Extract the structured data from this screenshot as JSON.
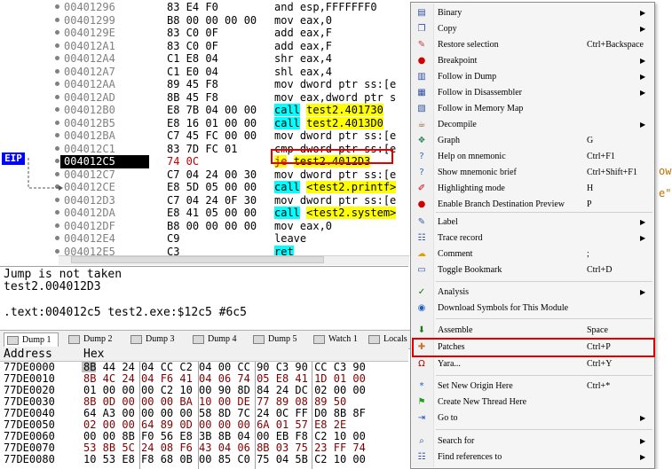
{
  "disasm": {
    "eip_label": "EIP",
    "rows": [
      {
        "addr": "00401296",
        "bytes": "83 E4 F0",
        "ins": "and esp,FFFFFFF0"
      },
      {
        "addr": "00401299",
        "bytes": "B8 00 00 00 00",
        "ins": "mov eax,0"
      },
      {
        "addr": "0040129E",
        "bytes": "83 C0 0F",
        "ins": "add eax,F"
      },
      {
        "addr": "004012A1",
        "bytes": "83 C0 0F",
        "ins": "add eax,F"
      },
      {
        "addr": "004012A4",
        "bytes": "C1 E8 04",
        "ins": "shr eax,4"
      },
      {
        "addr": "004012A7",
        "bytes": "C1 E0 04",
        "ins": "shl eax,4"
      },
      {
        "addr": "004012AA",
        "bytes": "89 45 F8",
        "ins": "mov dword ptr ss:[e"
      },
      {
        "addr": "004012AD",
        "bytes": "8B 45 F8",
        "ins": "mov eax,dword ptr s"
      },
      {
        "addr": "004012B0",
        "bytes": "E8 7B 04 00 00",
        "ins_call": "call",
        "ins_target": "test2.401730"
      },
      {
        "addr": "004012B5",
        "bytes": "E8 16 01 00 00",
        "ins_call": "call",
        "ins_target": "test2.4013D0"
      },
      {
        "addr": "004012BA",
        "bytes": "C7 45 FC 00 00",
        "ins": "mov dword ptr ss:[e"
      },
      {
        "addr": "004012C1",
        "bytes": "83 7D FC 01",
        "ins": "cmp dword ptr ss:[e"
      },
      {
        "addr": "004012C5",
        "bytes": "74 0C",
        "ins_je": "je",
        "ins_target": "test2.4012D3"
      },
      {
        "addr": "004012C7",
        "bytes": "C7 04 24 00 30",
        "ins": "mov dword ptr ss:[e"
      },
      {
        "addr": "004012CE",
        "bytes": "E8 5D 05 00 00",
        "ins_call": "call",
        "ins_target": "<test2.printf>"
      },
      {
        "addr": "004012D3",
        "bytes": "C7 04 24 0F 30",
        "ins": "mov dword ptr ss:[e"
      },
      {
        "addr": "004012DA",
        "bytes": "E8 41 05 00 00",
        "ins_call": "call",
        "ins_target": "<test2.system>"
      },
      {
        "addr": "004012DF",
        "bytes": "B8 00 00 00 00",
        "ins": "mov eax,0"
      },
      {
        "addr": "004012E4",
        "bytes": "C9",
        "ins": "leave"
      },
      {
        "addr": "004012E5",
        "bytes": "C3",
        "ins_ret": "ret"
      }
    ],
    "side_fragments": [
      "ow",
      "e\""
    ]
  },
  "info": {
    "line1": "Jump is not taken",
    "line2": "test2.004012D3",
    "line3": ".text:004012c5 test2.exe:$12c5 #6c5"
  },
  "tabs": [
    {
      "label": "Dump 1",
      "active": true
    },
    {
      "label": "Dump 2"
    },
    {
      "label": "Dump 3"
    },
    {
      "label": "Dump 4"
    },
    {
      "label": "Dump 5"
    },
    {
      "label": "Watch 1"
    },
    {
      "label": "Locals"
    }
  ],
  "dump": {
    "header_address": "Address",
    "header_hex": "Hex",
    "rows": [
      {
        "addr": "77DE0000",
        "hex": "8B 44 24 04 CC C2 04 00 CC 90 C3 90 CC C3 90"
      },
      {
        "addr": "77DE0010",
        "hex": "8B 4C 24 04 F6 41 04 06 74 05 E8 41 1D 01 00"
      },
      {
        "addr": "77DE0020",
        "hex": "01 00 00 00 C2 10 00 90 8D 84 24 DC 02 00 00"
      },
      {
        "addr": "77DE0030",
        "hex": "8B 0D 00 00 00 BA 10 00 DE 77 89 08 89 50"
      },
      {
        "addr": "77DE0040",
        "hex": "64 A3 00 00 00 00 58 8D 7C 24 0C FF D0 8B 8F"
      },
      {
        "addr": "77DE0050",
        "hex": "02 00 00 64 89 0D 00 00 00 6A 01 57 E8 2E"
      },
      {
        "addr": "77DE0060",
        "hex": "00 00 8B F0 56 E8 3B 8B 04 00 EB F8 C2 10 00"
      },
      {
        "addr": "77DE0070",
        "hex": "53 8B 5C 24 08 F6 43 04 06 8B 03 75 23 FF 74"
      },
      {
        "addr": "77DE0080",
        "hex": "10 53 E8 F8 68 0B 00 85 C0 75 04 5B C2 10 00"
      }
    ]
  },
  "menu": {
    "items": [
      {
        "icon": "binary-icon",
        "glyph": "▤",
        "label": "Binary",
        "submenu": true
      },
      {
        "icon": "copy-icon",
        "glyph": "❐",
        "label": "Copy",
        "submenu": true
      },
      {
        "icon": "restore-icon",
        "glyph": "✎",
        "label": "Restore selection",
        "shortcut": "Ctrl+Backspace"
      },
      {
        "icon": "breakpoint-icon",
        "glyph": "●",
        "label": "Breakpoint",
        "submenu": true
      },
      {
        "icon": "dump-icon",
        "glyph": "▥",
        "label": "Follow in Dump",
        "submenu": true
      },
      {
        "icon": "disassembler-icon",
        "glyph": "▦",
        "label": "Follow in Disassembler",
        "submenu": true
      },
      {
        "icon": "memory-map-icon",
        "glyph": "▧",
        "label": "Follow in Memory Map"
      },
      {
        "icon": "decompile-icon",
        "glyph": "☕",
        "label": "Decompile",
        "submenu": true
      },
      {
        "icon": "graph-icon",
        "glyph": "❖",
        "label": "Graph",
        "shortcut": "G"
      },
      {
        "icon": "help-icon",
        "glyph": "?",
        "label": "Help on mnemonic",
        "shortcut": "Ctrl+F1"
      },
      {
        "icon": "brief-icon",
        "glyph": "?",
        "label": "Show mnemonic brief",
        "shortcut": "Ctrl+Shift+F1"
      },
      {
        "icon": "highlight-icon",
        "glyph": "✐",
        "label": "Highlighting mode",
        "shortcut": "H"
      },
      {
        "icon": "branch-icon",
        "glyph": "●",
        "label": "Enable Branch Destination Preview",
        "shortcut": "P"
      },
      {
        "icon": "label-icon",
        "glyph": "✎",
        "label": "Label",
        "submenu": true
      },
      {
        "icon": "trace-icon",
        "glyph": "☷",
        "label": "Trace record",
        "submenu": true
      },
      {
        "icon": "comment-icon",
        "glyph": "☁",
        "label": "Comment",
        "shortcut": ";"
      },
      {
        "icon": "bookmark-icon",
        "glyph": "▭",
        "label": "Toggle Bookmark",
        "shortcut": "Ctrl+D"
      },
      {
        "icon": "analysis-icon",
        "glyph": "✓",
        "label": "Analysis",
        "submenu": true
      },
      {
        "icon": "symbols-icon",
        "glyph": "◉",
        "label": "Download Symbols for This Module"
      },
      {
        "icon": "assemble-icon",
        "glyph": "⬇",
        "label": "Assemble",
        "shortcut": "Space"
      },
      {
        "icon": "patches-icon",
        "glyph": "✚",
        "label": "Patches",
        "shortcut": "Ctrl+P"
      },
      {
        "icon": "yara-icon",
        "glyph": "Ω",
        "label": "Yara...",
        "shortcut": "Ctrl+Y"
      },
      {
        "icon": "origin-icon",
        "glyph": "*",
        "label": "Set New Origin Here",
        "shortcut": "Ctrl+*"
      },
      {
        "icon": "thread-icon",
        "glyph": "⚑",
        "label": "Create New Thread Here"
      },
      {
        "icon": "goto-icon",
        "glyph": "⇥",
        "label": "Go to",
        "submenu": true
      },
      {
        "icon": "search-icon",
        "glyph": "⌕",
        "label": "Search for",
        "submenu": true
      },
      {
        "icon": "references-icon",
        "glyph": "☷",
        "label": "Find references to",
        "submenu": true
      }
    ]
  },
  "colors": {
    "call_bg": "#00ffff",
    "target_bg": "#ffff00",
    "highlight_box": "#e00000",
    "eip_bg": "#0000ff"
  }
}
